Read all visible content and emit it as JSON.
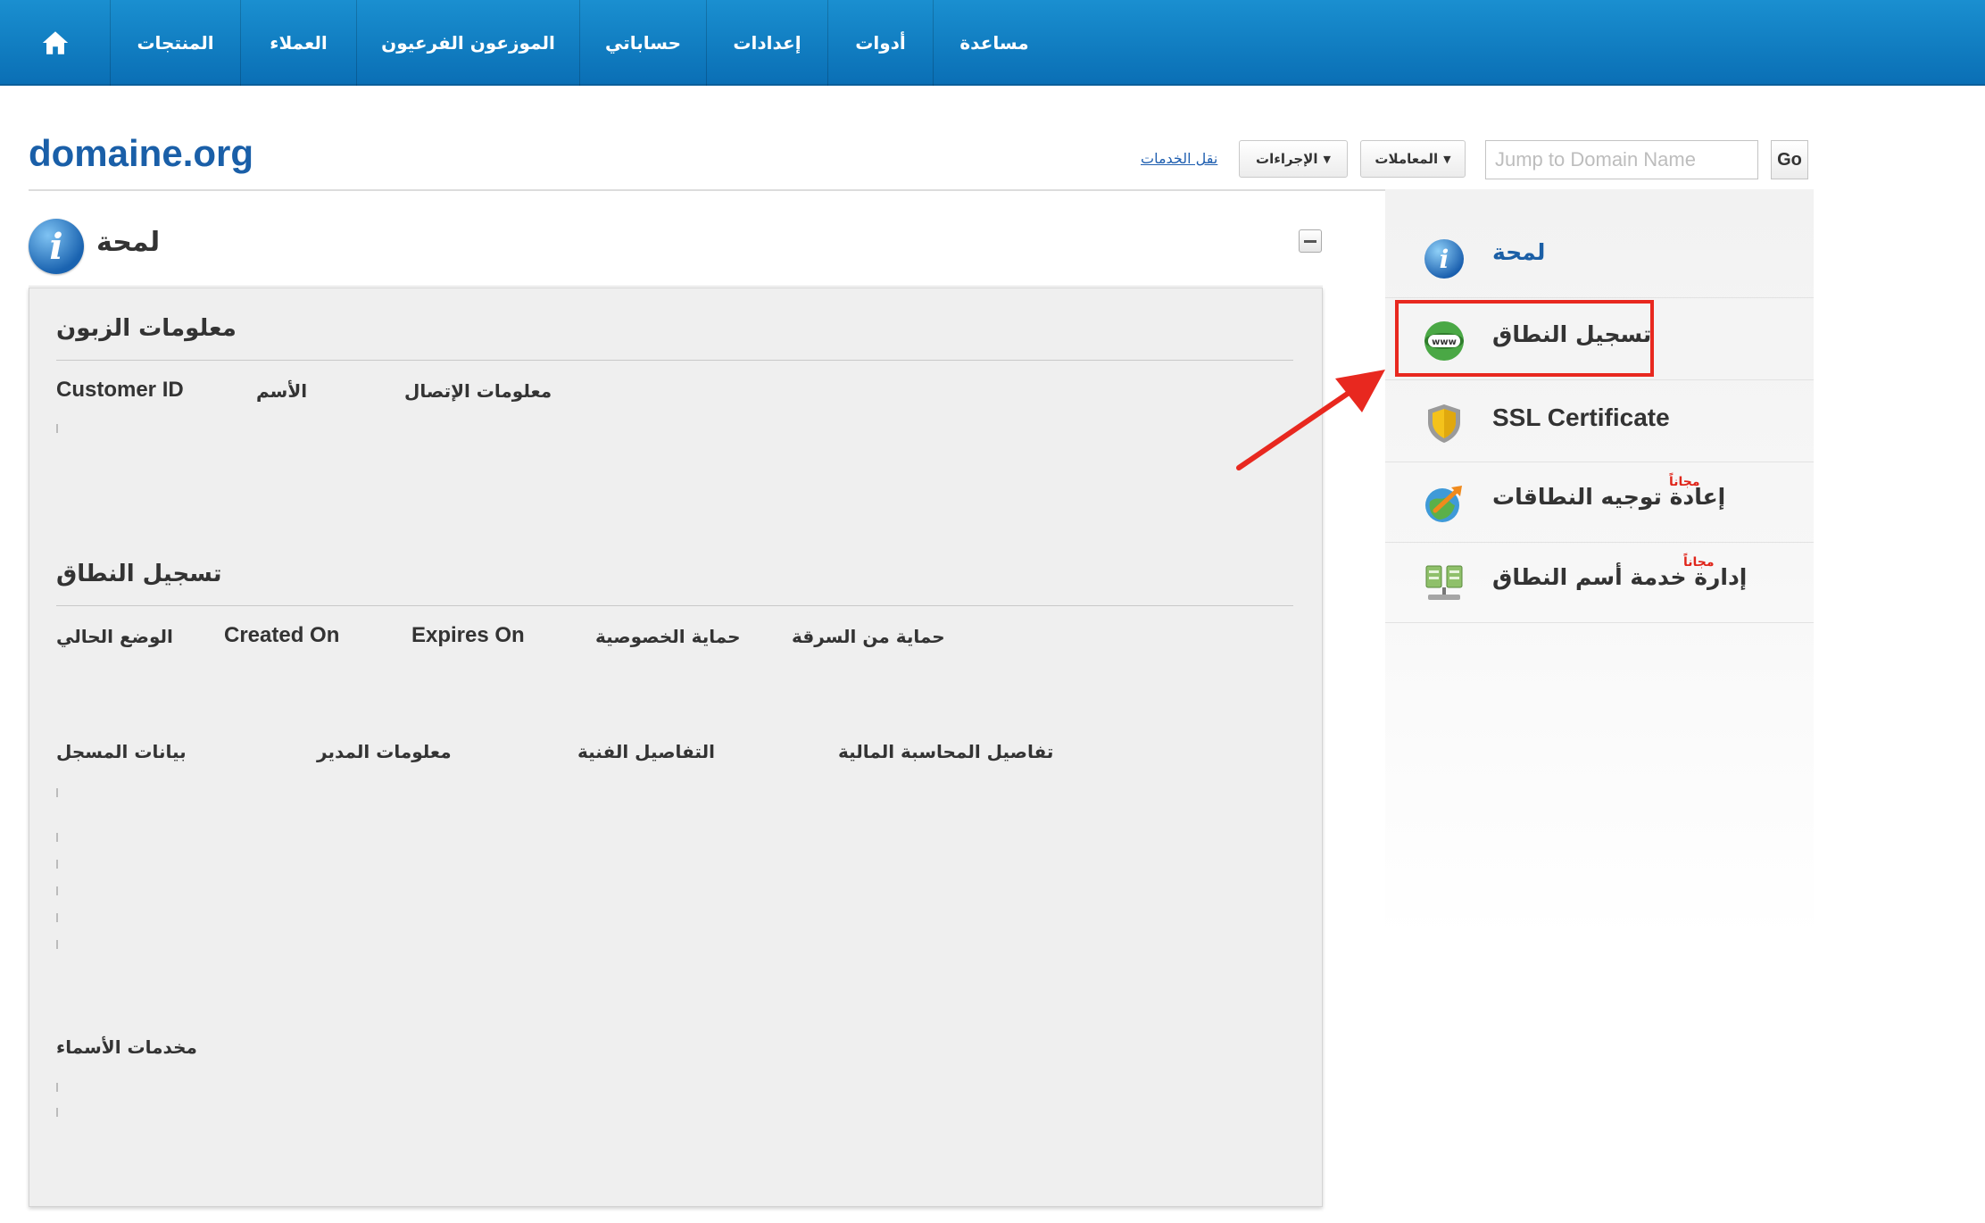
{
  "nav": {
    "items": [
      "المنتجات",
      "العملاء",
      "الموزعون الفرعيون",
      "حساباتي",
      "إعدادات",
      "أدوات",
      "مساعدة"
    ]
  },
  "header": {
    "domain": "domaine.org",
    "transfer_link": "نقل الخدمات",
    "actions_label": "الإجراءات",
    "transactions_label": "المعاملات",
    "jump_placeholder": "Jump to Domain Name",
    "go_label": "Go"
  },
  "section": {
    "title": "لمحة"
  },
  "customer": {
    "heading": "معلومات الزبون",
    "col_id": "Customer ID",
    "col_name": "الأسم",
    "col_contact": "معلومات الإتصال"
  },
  "registration": {
    "heading": "تسجيل النطاق",
    "col_status": "الوضع الحالي",
    "col_created": "Created On",
    "col_expires": "Expires On",
    "col_privacy": "حماية الخصوصية",
    "col_theft": "حماية من السرقة",
    "col_registrant": "بيانات المسجل",
    "col_admin": "معلومات المدير",
    "col_tech": "التفاصيل الفنية",
    "col_billing": "تفاصيل المحاسبة المالية",
    "nameservers": "مخدمات الأسماء"
  },
  "sidebar": {
    "items": [
      {
        "label": "لمحة",
        "icon": "info-icon"
      },
      {
        "label": "تسجيل النطاق",
        "icon": "www-globe-icon"
      },
      {
        "label": "SSL Certificate",
        "icon": "shield-icon"
      },
      {
        "label": "إعادة توجيه النطاقات",
        "icon": "redirect-globe-icon",
        "badge": "مجاناً"
      },
      {
        "label": "إدارة خدمة أسم النطاق",
        "icon": "dns-servers-icon",
        "badge": "مجاناً"
      }
    ]
  },
  "colors": {
    "nav": "#0a6fb5",
    "domain_title": "#1a5fa8",
    "highlight": "#e8281f",
    "free_badge": "#e0261b"
  }
}
